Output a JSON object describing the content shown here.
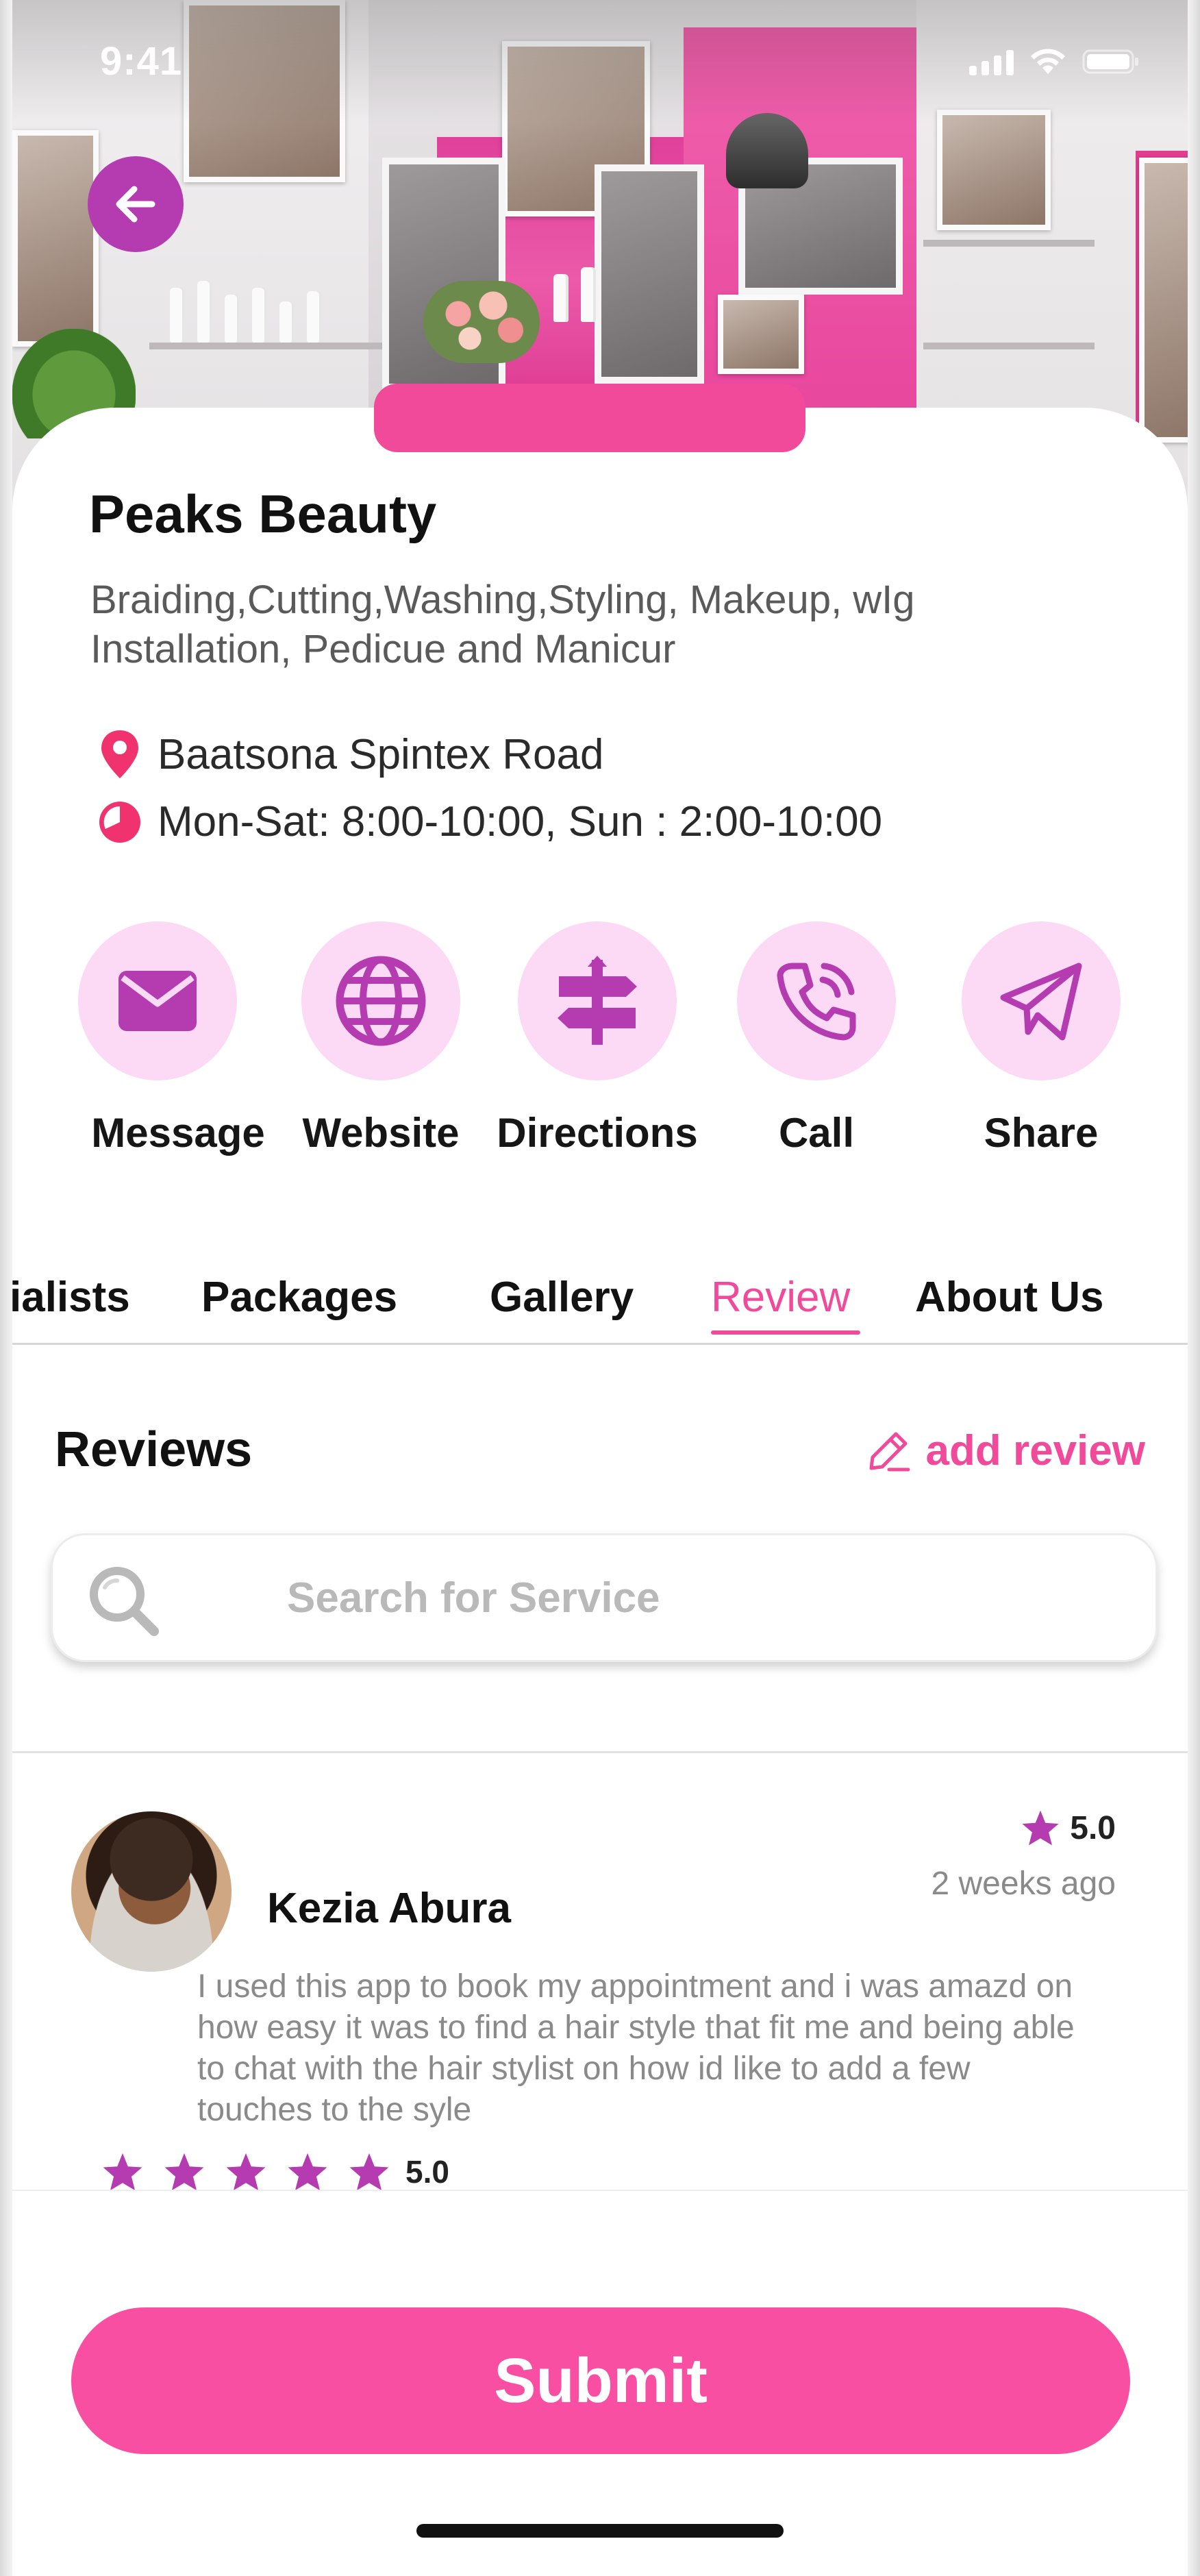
{
  "status_bar": {
    "time": "9:41"
  },
  "salon": {
    "name": "Peaks Beauty",
    "services": "Braiding,Cutting,Washing,Styling, Makeup, wIg\n Installation, Pedicue and Manicur",
    "location": "Baatsona Spintex Road",
    "hours": "Mon-Sat: 8:00-10:00, Sun : 2:00-10:00"
  },
  "actions": [
    {
      "label": "Message",
      "icon": "envelope-icon"
    },
    {
      "label": "Website",
      "icon": "globe-icon"
    },
    {
      "label": "Directions",
      "icon": "signpost-icon"
    },
    {
      "label": "Call",
      "icon": "phone-icon"
    },
    {
      "label": "Share",
      "icon": "paper-plane-icon"
    }
  ],
  "tabs": [
    {
      "label": "ialists",
      "active": false
    },
    {
      "label": "Packages",
      "active": false
    },
    {
      "label": "Gallery",
      "active": false
    },
    {
      "label": "Review",
      "active": true
    },
    {
      "label": "About Us",
      "active": false
    }
  ],
  "reviews": {
    "title": "Reviews",
    "add_review_label": "add review",
    "search_placeholder": "Search for Service",
    "items": [
      {
        "name": "Kezia Abura",
        "rating": "5.0",
        "date": "2 weeks ago",
        "text": "I used this app to book my appointment and i was amazd on how easy it was to find a hair style that fit me and being able to chat with the hair stylist on how id like to add a few touches to the syle",
        "stars": 5,
        "stars_value": "5.0"
      }
    ]
  },
  "footer": {
    "submit_label": "Submit"
  },
  "colors": {
    "accent_pink": "#f14a9a",
    "button_pink": "#f84fa3",
    "purple": "#b53bb0",
    "icon_bg": "#fcd9f4",
    "location_red": "#f0336e"
  }
}
